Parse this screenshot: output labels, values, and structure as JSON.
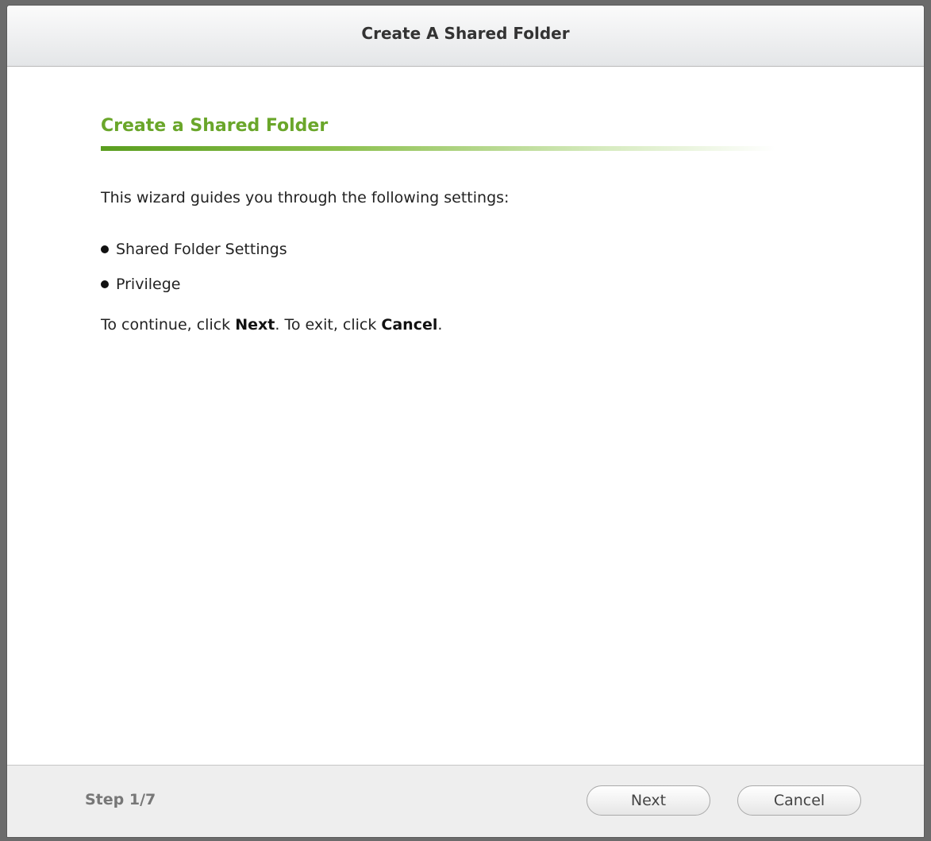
{
  "window": {
    "title": "Create A Shared Folder"
  },
  "content": {
    "heading": "Create a Shared Folder",
    "intro": "This wizard guides you through the following settings:",
    "bullets": [
      "Shared Folder Settings",
      "Privilege"
    ],
    "continue_prefix": "To continue, click ",
    "continue_next": "Next",
    "continue_middle": ". To exit, click ",
    "continue_cancel": "Cancel",
    "continue_suffix": "."
  },
  "footer": {
    "step": "Step 1/7",
    "next_label": "Next",
    "cancel_label": "Cancel"
  },
  "colors": {
    "accent_green": "#6aa62a",
    "title_text": "#333333"
  }
}
